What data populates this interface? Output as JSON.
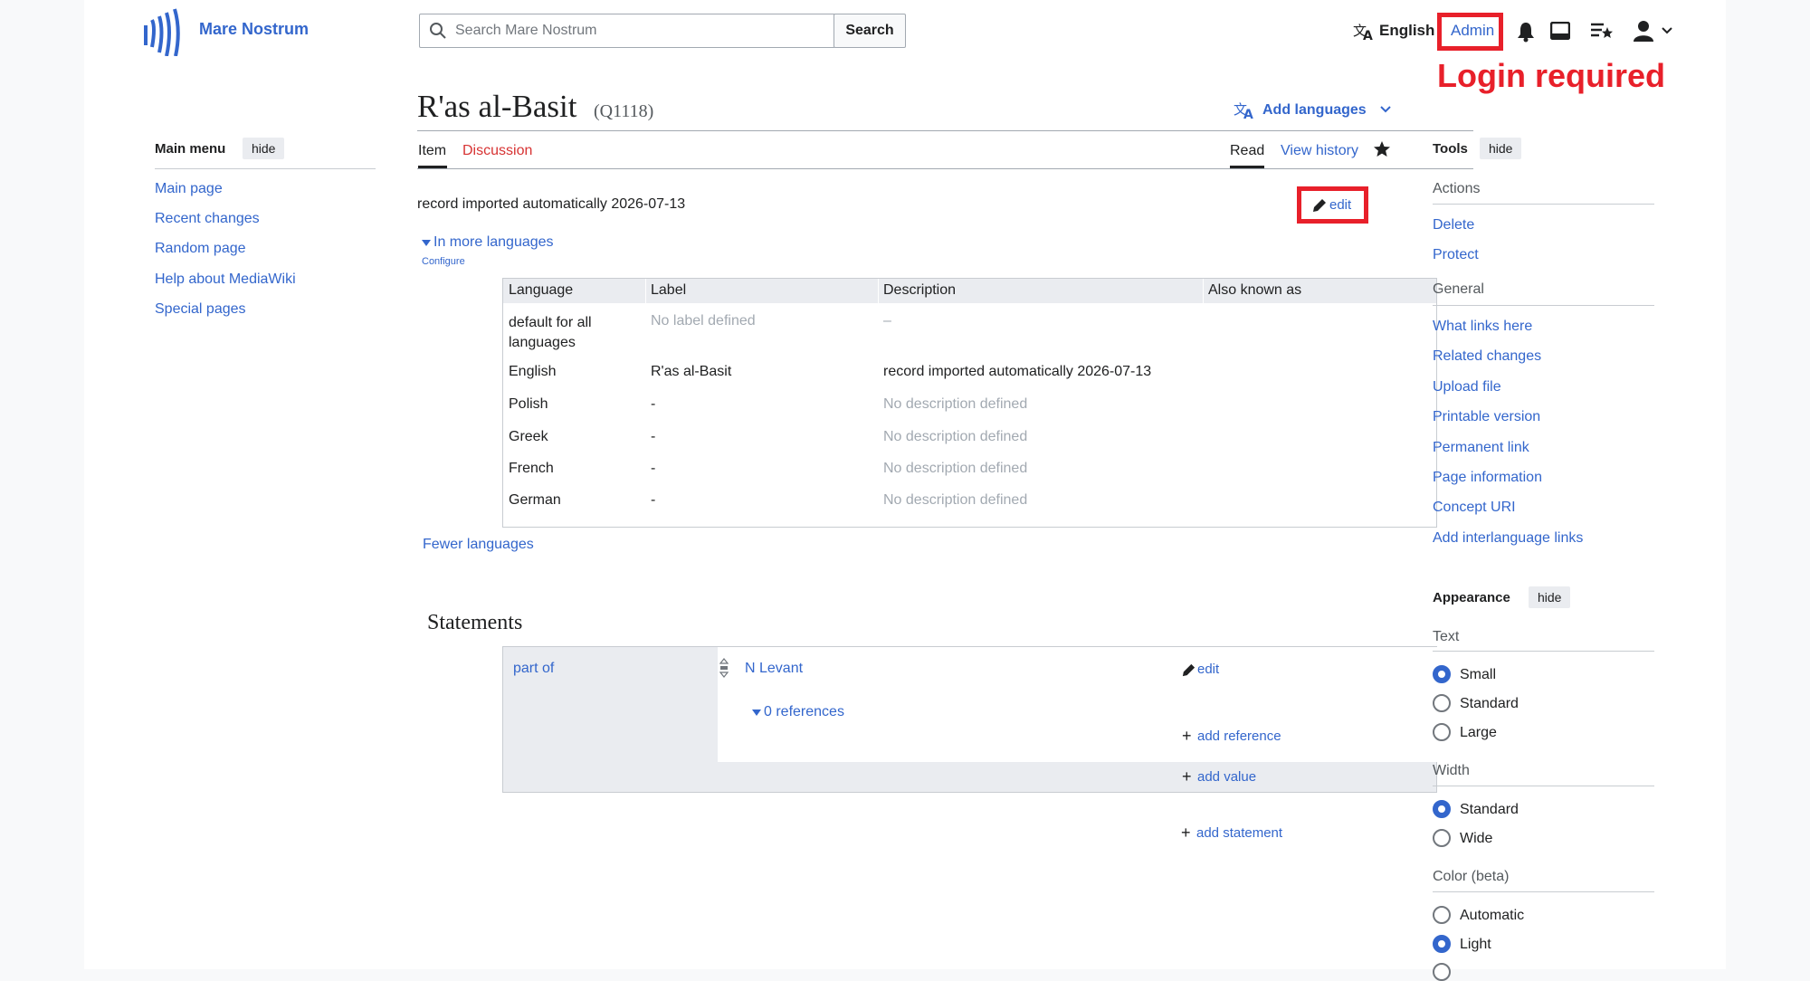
{
  "site": {
    "name": "Mare Nostrum"
  },
  "header": {
    "search_placeholder": "Search Mare Nostrum",
    "search_button": "Search",
    "language": "English",
    "user": "Admin"
  },
  "annotation": {
    "login_required": "Login required"
  },
  "page": {
    "title": "R'as al-Basit",
    "id": "(Q1118)",
    "add_languages": "Add languages",
    "tabs": {
      "item": "Item",
      "discussion": "Discussion",
      "read": "Read",
      "view_history": "View history"
    },
    "description": "record imported automatically 2026-07-13",
    "edit": "edit",
    "in_more_languages": "In more languages",
    "configure": "Configure",
    "fewer_languages": "Fewer languages"
  },
  "lang_table": {
    "headers": [
      "Language",
      "Label",
      "Description",
      "Also known as"
    ],
    "rows": [
      {
        "language": "default for all languages",
        "label": "No label defined",
        "description": "–"
      },
      {
        "language": "English",
        "label": "R'as al-Basit",
        "description": "record imported automatically 2026-07-13"
      },
      {
        "language": "Polish",
        "label": "-",
        "description": "No description defined"
      },
      {
        "language": "Greek",
        "label": "-",
        "description": "No description defined"
      },
      {
        "language": "French",
        "label": "-",
        "description": "No description defined"
      },
      {
        "language": "German",
        "label": "-",
        "description": "No description defined"
      }
    ]
  },
  "statements": {
    "heading": "Statements",
    "property": "part of",
    "value": "N Levant",
    "edit": "edit",
    "references": "0 references",
    "add_reference": "add reference",
    "add_value": "add value",
    "add_statement": "add statement"
  },
  "main_menu": {
    "title": "Main menu",
    "hide": "hide",
    "items": [
      "Main page",
      "Recent changes",
      "Random page",
      "Help about MediaWiki",
      "Special pages"
    ]
  },
  "tools": {
    "title": "Tools",
    "hide": "hide",
    "actions_heading": "Actions",
    "actions": [
      "Delete",
      "Protect"
    ],
    "general_heading": "General",
    "general": [
      "What links here",
      "Related changes",
      "Upload file",
      "Printable version",
      "Permanent link",
      "Page information",
      "Concept URI",
      "Add interlanguage links"
    ]
  },
  "appearance": {
    "title": "Appearance",
    "hide": "hide",
    "text_heading": "Text",
    "text_options": [
      "Small",
      "Standard",
      "Large"
    ],
    "text_selected": "Small",
    "width_heading": "Width",
    "width_options": [
      "Standard",
      "Wide"
    ],
    "width_selected": "Standard",
    "color_heading": "Color (beta)",
    "color_options": [
      "Automatic",
      "Light"
    ],
    "color_selected": "Light"
  },
  "colors": {
    "link": "#3366cc",
    "annotation": "#e8202a",
    "logo": "#36c"
  }
}
